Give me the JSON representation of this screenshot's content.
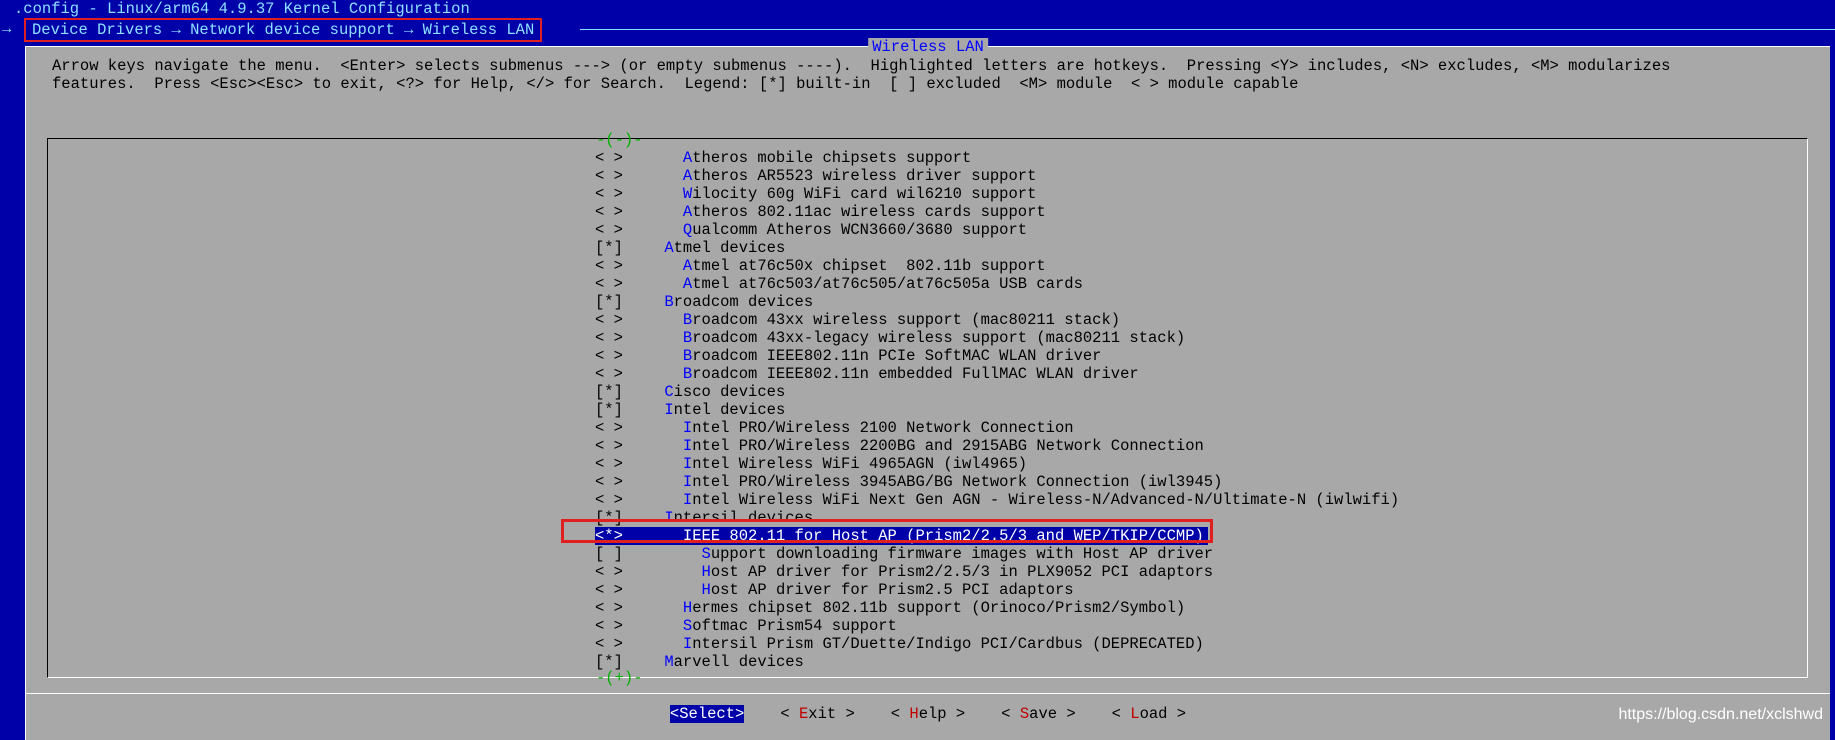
{
  "window_title": ".config - Linux/arm64 4.9.37 Kernel Configuration",
  "breadcrumb": "Device Drivers → Network device support → Wireless LAN",
  "breadcrumb_arrow": "→",
  "dialog_title": "Wireless LAN",
  "help_text": "Arrow keys navigate the menu.  <Enter> selects submenus ---> (or empty submenus ----).  Highlighted letters are hotkeys.  Pressing <Y> includes, <N> excludes, <M> modularizes\nfeatures.  Press <Esc><Esc> to exit, <?> for Help, </> for Search.  Legend: [*] built-in  [ ] excluded  <M> module  < > module capable",
  "scroll_up": "-(-)-",
  "scroll_down": "-(+)-",
  "menu_items": [
    {
      "state": "< >",
      "indent": "   ",
      "hot": "A",
      "rest": "theros mobile chipsets support"
    },
    {
      "state": "< >",
      "indent": "   ",
      "hot": "A",
      "rest": "theros AR5523 wireless driver support"
    },
    {
      "state": "< >",
      "indent": "   ",
      "hot": "W",
      "rest": "ilocity 60g WiFi card wil6210 support"
    },
    {
      "state": "< >",
      "indent": "   ",
      "hot": "A",
      "rest": "theros 802.11ac wireless cards support"
    },
    {
      "state": "< >",
      "indent": "   ",
      "hot": "Q",
      "rest": "ualcomm Atheros WCN3660/3680 support"
    },
    {
      "state": "[*]",
      "indent": " ",
      "hot": "A",
      "rest": "tmel devices"
    },
    {
      "state": "< >",
      "indent": "   ",
      "hot": "A",
      "rest": "tmel at76c50x chipset  802.11b support"
    },
    {
      "state": "< >",
      "indent": "   ",
      "hot": "A",
      "rest": "tmel at76c503/at76c505/at76c505a USB cards"
    },
    {
      "state": "[*]",
      "indent": " ",
      "hot": "B",
      "rest": "roadcom devices"
    },
    {
      "state": "< >",
      "indent": "   ",
      "hot": "B",
      "rest": "roadcom 43xx wireless support (mac80211 stack)"
    },
    {
      "state": "< >",
      "indent": "   ",
      "hot": "B",
      "rest": "roadcom 43xx-legacy wireless support (mac80211 stack)"
    },
    {
      "state": "< >",
      "indent": "   ",
      "hot": "B",
      "rest": "roadcom IEEE802.11n PCIe SoftMAC WLAN driver"
    },
    {
      "state": "< >",
      "indent": "   ",
      "hot": "B",
      "rest": "roadcom IEEE802.11n embedded FullMAC WLAN driver"
    },
    {
      "state": "[*]",
      "indent": " ",
      "hot": "C",
      "rest": "isco devices"
    },
    {
      "state": "[*]",
      "indent": " ",
      "hot": "I",
      "rest": "ntel devices"
    },
    {
      "state": "< >",
      "indent": "   ",
      "hot": "I",
      "rest": "ntel PRO/Wireless 2100 Network Connection"
    },
    {
      "state": "< >",
      "indent": "   ",
      "hot": "I",
      "rest": "ntel PRO/Wireless 2200BG and 2915ABG Network Connection"
    },
    {
      "state": "< >",
      "indent": "   ",
      "hot": "I",
      "rest": "ntel Wireless WiFi 4965AGN (iwl4965)"
    },
    {
      "state": "< >",
      "indent": "   ",
      "hot": "I",
      "rest": "ntel PRO/Wireless 3945ABG/BG Network Connection (iwl3945)"
    },
    {
      "state": "< >",
      "indent": "   ",
      "hot": "I",
      "rest": "ntel Wireless WiFi Next Gen AGN - Wireless-N/Advanced-N/Ultimate-N (iwlwifi)"
    },
    {
      "state": "[*]",
      "indent": " ",
      "hot": "I",
      "rest": "ntersil devices"
    },
    {
      "state": "<*>",
      "indent": "   ",
      "hot": "I",
      "rest": "EEE 802.11 for Host AP (Prism2/2.5/3 and WEP/TKIP/CCMP)",
      "selected": true
    },
    {
      "state": "[ ]",
      "indent": "     ",
      "hot": "S",
      "rest": "upport downloading firmware images with Host AP driver"
    },
    {
      "state": "< >",
      "indent": "     ",
      "hot": "H",
      "rest": "ost AP driver for Prism2/2.5/3 in PLX9052 PCI adaptors"
    },
    {
      "state": "< >",
      "indent": "     ",
      "hot": "H",
      "rest": "ost AP driver for Prism2.5 PCI adaptors"
    },
    {
      "state": "< >",
      "indent": "   ",
      "hot": "H",
      "rest": "ermes chipset 802.11b support (Orinoco/Prism2/Symbol)"
    },
    {
      "state": "< >",
      "indent": "   ",
      "hot": "S",
      "rest": "oftmac Prism54 support"
    },
    {
      "state": "< >",
      "indent": "   ",
      "hot": "I",
      "rest": "ntersil Prism GT/Duette/Indigo PCI/Cardbus (DEPRECATED)"
    },
    {
      "state": "[*]",
      "indent": " ",
      "hot": "M",
      "rest": "arvell devices"
    }
  ],
  "buttons": [
    {
      "pre": "<",
      "hot": "S",
      "rest": "elect>",
      "active": true
    },
    {
      "pre": "< ",
      "hot": "E",
      "rest": "xit >",
      "active": false
    },
    {
      "pre": "< ",
      "hot": "H",
      "rest": "elp >",
      "active": false
    },
    {
      "pre": "< ",
      "hot": "S",
      "rest": "ave >",
      "active": false
    },
    {
      "pre": "< ",
      "hot": "L",
      "rest": "oad >",
      "active": false
    }
  ],
  "watermark": "https://blog.csdn.net/xclshwd",
  "colors": {
    "screen_bg": "#0000a8",
    "dialog_bg": "#a8a8a8",
    "hotkey": "#0000ff",
    "button_hotkey": "#c00000",
    "annotation_red": "#e02020"
  }
}
